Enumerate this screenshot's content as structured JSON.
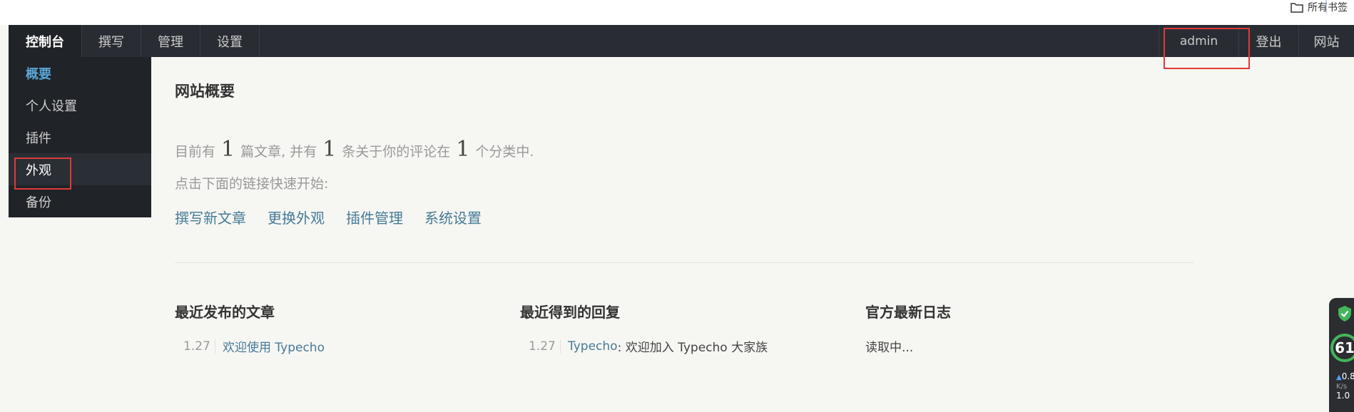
{
  "bookmarks": {
    "folder_label": "所有书签"
  },
  "topbar": {
    "menu": [
      "控制台",
      "撰写",
      "管理",
      "设置"
    ],
    "user": "admin",
    "logout": "登出",
    "site": "网站"
  },
  "submenu": {
    "items": [
      "概要",
      "个人设置",
      "插件",
      "外观",
      "备份"
    ]
  },
  "main": {
    "title": "网站概要",
    "stats": {
      "p1": "目前有",
      "posts": "1",
      "p2": "篇文章, 并有",
      "comments": "1",
      "p3": "条关于你的评论在",
      "categories": "1",
      "p4": "个分类中."
    },
    "hint": "点击下面的链接快速开始:",
    "quick_links": [
      "撰写新文章",
      "更换外观",
      "插件管理",
      "系统设置"
    ],
    "recent_posts": {
      "title": "最近发布的文章",
      "items": [
        {
          "date": "1.27",
          "title": "欢迎使用 Typecho"
        }
      ]
    },
    "recent_comments": {
      "title": "最近得到的回复",
      "items": [
        {
          "date": "1.27",
          "author": "Typecho",
          "text": ": 欢迎加入 Typecho 大家族"
        }
      ]
    },
    "official_log": {
      "title": "官方最新日志",
      "loading": "读取中..."
    }
  },
  "widget": {
    "score": "61",
    "speed_value": "0.8",
    "speed_unit": "K/s",
    "speed_value2": "1.0"
  },
  "colors": {
    "accent_link": "#467b96",
    "topbar_bg": "#292d33",
    "submenu_bg": "#202328",
    "highlight": "#e03a3a",
    "active_submenu": "#5aa6d6"
  }
}
